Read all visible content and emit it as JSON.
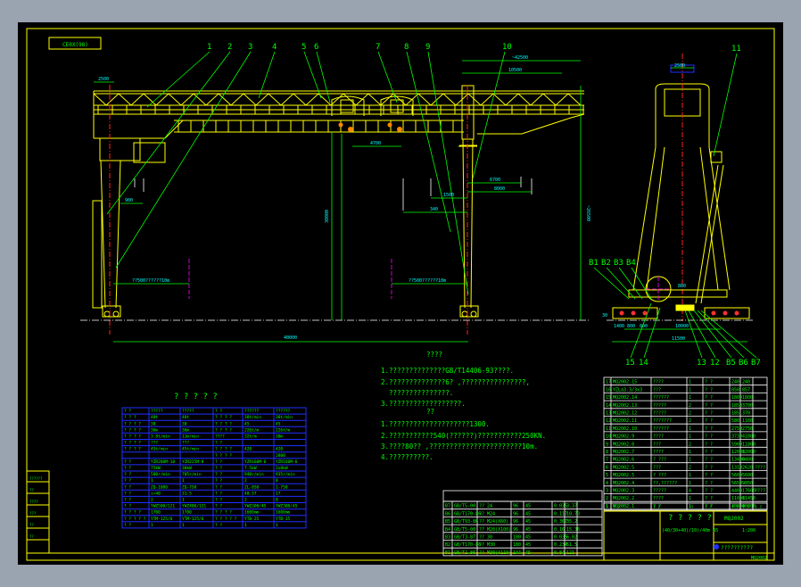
{
  "drawing": {
    "title_box": "CE0X(98)",
    "leader_numbers_front": [
      "1",
      "2",
      "3",
      "4",
      "5",
      "6",
      "7",
      "8",
      "9",
      "10"
    ],
    "leader_numbers_side": [
      "11",
      "B1",
      "B2",
      "B3",
      "B4",
      "15",
      "14",
      "13",
      "12",
      "B5",
      "B6",
      "B7"
    ],
    "dimensions": {
      "overhang_left": "2500",
      "hook_spacing": "4700",
      "overall_length": "~42500",
      "cantilever": "10500",
      "span": "40000",
      "height_right": "~26500",
      "height_lift": "30000",
      "lift_detail": "1500",
      "right_dim_a": "6700",
      "right_dim_b": "8000",
      "lower_dim": "340",
      "side_top": "2500",
      "side_base": "11500",
      "side_track": "10000",
      "side_wheel_a": "1400",
      "side_wheel_b": "800",
      "side_wheel_c": "800",
      "side_level": "800",
      "side_small": "30",
      "left_small": "900",
      "limit_left": "??500??????10m",
      "limit_right": "??500??????10m"
    }
  },
  "notes": {
    "heading1": "????",
    "items1": [
      "1.??????????????GB/T14406-93????.",
      "2.??????????????6? ,????????????????,",
      "  ???????????????.",
      "3.??????????????????."
    ],
    "heading2": "??",
    "items2": [
      "1.????????????????????1300.",
      "2.???????????540(??????)???????????250KN.",
      "3.????80?? ,???????????????????????10m.",
      "4.??????????."
    ]
  },
  "spec_table": {
    "title": "? ? ? ? ?",
    "rows": [
      [
        "? ?",
        "?????",
        "?????",
        "? ?",
        "??????",
        "??????"
      ],
      [
        "? ? ?",
        "40t",
        "40t",
        "? ? ? ?",
        "38t/min",
        "38t/min"
      ],
      [
        "? ? ? ?",
        "30",
        "30",
        "? ? ? ?",
        "45",
        "45"
      ],
      [
        "? ? ? ?",
        "36m",
        "36m",
        "? ? ? ?",
        "226t/m",
        "226t/m"
      ],
      [
        "? ? ? ?",
        "3.8t/min",
        "11m/min",
        "????",
        "32t/m",
        "30m"
      ],
      [
        "? ? ? ?",
        "???",
        "???",
        "? ?",
        "",
        ""
      ],
      [
        "? ? ? ?",
        "45t/min",
        "45t/min",
        "? ? ? ?",
        "420",
        "420"
      ],
      [
        "",
        "",
        "",
        "? ? ? ?",
        "",
        "2800"
      ],
      [
        "? ?",
        "YZR280M-10",
        "YZR225M-8",
        "? ?",
        "YZR160M-6",
        "YZR160M-6"
      ],
      [
        "? ?",
        "75kW",
        "30kW",
        "? ?",
        "7.5kW",
        "2x8kW"
      ],
      [
        "? ?",
        "580r/min",
        "705r/min",
        "? ?",
        "940r/min",
        "935r/min"
      ],
      [
        "? ?",
        "1",
        "1",
        "? ?",
        "2",
        "8"
      ],
      [
        "? ?",
        "ZQ-1000",
        "ZQ-750",
        "? ?",
        "ZL-850",
        "1-750"
      ],
      [
        "? ?",
        "i=40",
        "31.5",
        "? ?",
        "48.57",
        "17"
      ],
      [
        "? ?",
        "2",
        "1",
        "? ?",
        "2",
        "8"
      ],
      [
        "? ?",
        "YWZ500/121",
        "YWZ400/121",
        "? ?",
        "YWZ300/45",
        "YWZ300/45"
      ],
      [
        "? ? ? ?",
        "1700",
        "1700",
        "? ? ? ?",
        "1600mm",
        "1600mm"
      ],
      [
        "? ? ? ? ?",
        "YTM-125/6",
        "YTM-125/6",
        "? ? ? ? ?",
        "YTB-25",
        "YTB-25"
      ],
      [
        "? ?",
        "1",
        "1",
        "? ?",
        "1",
        "1"
      ]
    ]
  },
  "parts_table": {
    "rows": [
      [
        "B7",
        "GB/T5-00",
        "?? 24",
        "96",
        "45",
        "0.035",
        "3.37"
      ],
      [
        "B6",
        "GB/T170-86",
        "?? M24",
        "96",
        "45",
        "0.117",
        "10.73"
      ],
      [
        "B5",
        "GB/T93-86",
        "?? M24(X60)",
        "96",
        "45",
        "0.367",
        "35.2"
      ],
      [
        "B4",
        "GB/T5-00",
        "?? M20(X100)",
        "96",
        "45",
        "0.16",
        "15.36"
      ],
      [
        "B3",
        "GB/T3-87",
        "?? 30",
        "180",
        "45",
        "0.035",
        "6.02"
      ],
      [
        "B2",
        "GB/T170-86",
        "?? M30",
        "180",
        "45",
        "0.234",
        "51.5"
      ],
      [
        "B1",
        "GB/T2-86",
        "?? M30(X110)",
        "144",
        "45",
        "0.84",
        "121"
      ]
    ]
  },
  "bom_table": {
    "rows": [
      [
        "17",
        "MQ2002.15",
        "????",
        "1",
        "? ?",
        "240",
        "240",
        ""
      ],
      [
        "16",
        "YZLa3.3/3x3",
        "???",
        "1",
        "? ?",
        "850",
        "857",
        ""
      ],
      [
        "15",
        "MQ2002.14",
        "??????",
        "1",
        "? ?",
        "1800",
        "1800",
        ""
      ],
      [
        "14",
        "MQ2002.13",
        "?????",
        "2",
        "? ?",
        "1850",
        "3700",
        ""
      ],
      [
        "13",
        "MQ2002.12",
        "?????",
        "2",
        "? ?",
        "185",
        "370",
        ""
      ],
      [
        "12",
        "MQ2002.11",
        "???????",
        "2",
        "? ?",
        "580",
        "1160",
        ""
      ],
      [
        "11",
        "MQ2002.10",
        "??????",
        "1",
        "? ?",
        "2750",
        "2750",
        ""
      ],
      [
        "10",
        "MQ2002.9",
        "????",
        "1",
        "? ?",
        "3730",
        "41000",
        ""
      ],
      [
        "9",
        "MQ2002.8",
        "???",
        "2",
        "? ?",
        "5900",
        "11800",
        ""
      ],
      [
        "8",
        "MQ2002.7",
        "????",
        "1",
        "? ?",
        "12000",
        "12000",
        ""
      ],
      [
        "7",
        "MQ2002.6",
        "? ???",
        "1",
        "? ?",
        "13400",
        "6400",
        ""
      ],
      [
        "6",
        "MQ2002.5",
        "???",
        "2",
        "? ?",
        "1310",
        "2620",
        "????"
      ],
      [
        "5",
        "MQ2002.5",
        "? ???",
        "1",
        "? ?",
        "5600",
        "5600",
        ""
      ],
      [
        "4",
        "MQ2002.4",
        "??,??????",
        "1",
        "? ?",
        "5650",
        "9850",
        ""
      ],
      [
        "3",
        "MQ2002.3",
        "?????",
        "4",
        "? ?",
        "4400",
        "17600",
        "????"
      ],
      [
        "2",
        "MQ2002.2",
        "????",
        "1",
        "? ?",
        "11000",
        "11450",
        ""
      ],
      [
        "1",
        "MQ2002.1",
        "? ?",
        "1",
        "? ?",
        "40000",
        "40000",
        ""
      ]
    ],
    "header": [
      "?",
      "? ?",
      "? ?",
      "??",
      "? ?",
      "? ?",
      "? ?",
      "? ?"
    ]
  },
  "title_block": {
    "name": "? ? ? ? ?",
    "spec": "(40/30+40)/10)/40m A5",
    "code": "MQ2002",
    "scale": "1:200",
    "company": "??????????",
    "sheet_no": "MQ2002"
  },
  "left_strip": {
    "labels": [
      "??????",
      "??",
      "????",
      "???",
      "??",
      "??"
    ]
  }
}
